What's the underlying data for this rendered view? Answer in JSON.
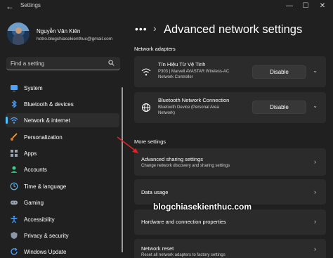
{
  "window": {
    "title": "Settings",
    "minimize_glyph": "—",
    "maximize_glyph": "☐",
    "close_glyph": "✕"
  },
  "user": {
    "name": "Nguyễn Văn Kiên",
    "email": "hotro.blogchiasekienthuc@gmail.com"
  },
  "search": {
    "placeholder": "Find a setting"
  },
  "sidebar": {
    "items": [
      {
        "label": "System",
        "icon": "system-icon",
        "selected": false
      },
      {
        "label": "Bluetooth & devices",
        "icon": "bluetooth-icon",
        "selected": false
      },
      {
        "label": "Network & internet",
        "icon": "wifi-icon",
        "selected": true
      },
      {
        "label": "Personalization",
        "icon": "brush-icon",
        "selected": false
      },
      {
        "label": "Apps",
        "icon": "apps-icon",
        "selected": false
      },
      {
        "label": "Accounts",
        "icon": "accounts-icon",
        "selected": false
      },
      {
        "label": "Time & language",
        "icon": "globe-clock-icon",
        "selected": false
      },
      {
        "label": "Gaming",
        "icon": "gamepad-icon",
        "selected": false
      },
      {
        "label": "Accessibility",
        "icon": "accessibility-icon",
        "selected": false
      },
      {
        "label": "Privacy & security",
        "icon": "shield-icon",
        "selected": false
      },
      {
        "label": "Windows Update",
        "icon": "update-icon",
        "selected": false
      }
    ]
  },
  "header": {
    "dots": "•••",
    "separator": "›",
    "title": "Advanced network settings"
  },
  "network_adapters": {
    "heading": "Network adapters",
    "adapters": [
      {
        "name": "Tín Hiệu Từ Vệ Tinh",
        "desc_line1": "P303 | Marvell AVASTAR Wireless-AC",
        "desc_line2": "Network Controller",
        "button": "Disable",
        "icon": "wifi-icon"
      },
      {
        "name": "Bluetooth Network Connection",
        "desc_line1": "Bluetooth Device (Personal Area",
        "desc_line2": "Network)",
        "button": "Disable",
        "icon": "globe-icon"
      }
    ]
  },
  "more_settings": {
    "heading": "More settings",
    "items": [
      {
        "title": "Advanced sharing settings",
        "subtitle": "Change network discovery and sharing settings"
      },
      {
        "title": "Data usage",
        "subtitle": ""
      },
      {
        "title": "Hardware and connection properties",
        "subtitle": ""
      },
      {
        "title": "Network reset",
        "subtitle": "Reset all network adapters to factory settings"
      }
    ]
  },
  "watermark": "blogchiasekienthuc.com",
  "colors": {
    "background": "#202020",
    "card": "#2b2b2b",
    "accent": "#4cc2ff",
    "arrow": "#e02424"
  }
}
